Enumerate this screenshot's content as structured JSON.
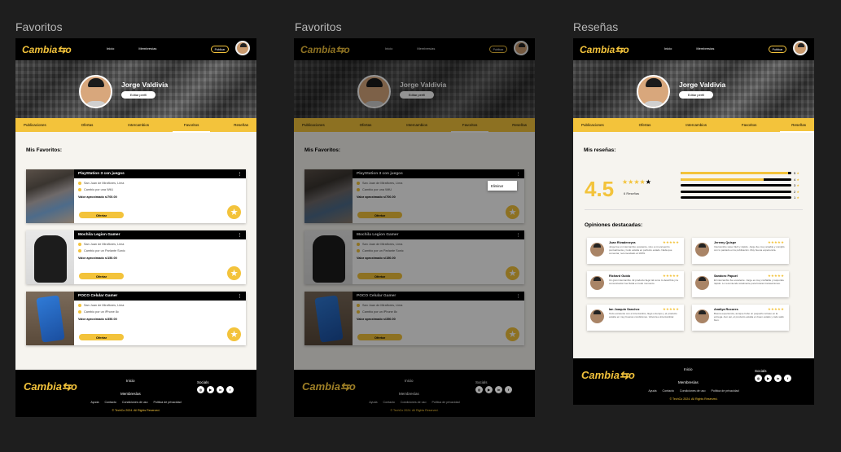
{
  "frames": [
    {
      "label": "Favoritos"
    },
    {
      "label": "Favoritos"
    },
    {
      "label": "Reseñas"
    }
  ],
  "nav": {
    "logo": "Cambia⇆o",
    "inicio": "Inicio",
    "membresias": "Membresías",
    "publicar": "Publicar"
  },
  "profile": {
    "name": "Jorge Valdivia",
    "edit": "Editar perfil"
  },
  "tabs": [
    "Publicaciones",
    "Ofertas",
    "Intercambios",
    "Favoritos",
    "Reseñas"
  ],
  "favorites": {
    "title": "Mis Favoritos:",
    "cards": [
      {
        "title": "PlayStation 3 con juegos",
        "location": "San Juan de Miraflores, Lima",
        "exchange": "Cambio por una WiiU",
        "value": "Valor aproximado s/700.00",
        "button": "Ofertar"
      },
      {
        "title": "Mochila Legion Gamer",
        "location": "San Juan de Miraflores, Lima",
        "exchange": "Cambio por un Parlante Sonic",
        "value": "Valor aproximado s/150.00",
        "button": "Ofertar"
      },
      {
        "title": "POCO Celular Gamer",
        "location": "San Juan de Miraflores, Lima",
        "exchange": "Cambio por un iPhone 8c",
        "value": "Valor aproximado s/350.00",
        "button": "Ofertar"
      }
    ],
    "menu_item": "Eliminar"
  },
  "reviews": {
    "title": "Mis reseñas:",
    "score": "4.5",
    "count": "6 Reseñas",
    "bars": [
      {
        "label": "5",
        "fill": 0.97
      },
      {
        "label": "4",
        "fill": 0.75
      },
      {
        "label": "3",
        "fill": 0
      },
      {
        "label": "2",
        "fill": 0
      },
      {
        "label": "1",
        "fill": 0
      }
    ],
    "highlights_title": "Opiniones destacadas:",
    "items": [
      {
        "name": "Juan Rivadeneyra",
        "stars": "★★★★★",
        "text": "Jorge fue un intercambio excelente, vino a mi encuentro puntualmente y todo estaba en perfecto estado. Nada que comentar, recomendado al 100%."
      },
      {
        "name": "Jeremy Quispe",
        "stars": "★★★★★",
        "text": "Intercambio súper fácil y rápido. Jorge fue muy amable y cumplió con lo pactado en la publicación. Muy buena experiencia."
      },
      {
        "name": "Richard Guido",
        "stars": "★★★★★",
        "text": "Un gran intercambio. El producto llegó tal como lo describía y la comunicación fue fluida en todo momento."
      },
      {
        "name": "Sandoro Papuel",
        "stars": "★★★★★",
        "text": "El intercambio fue excelente. Jorge es muy confiable y responde rápido. Lo recomiendo totalmente para futuras transacciones."
      },
      {
        "name": "Ian Joaquin Sanchez",
        "stars": "★★★★★",
        "text": "Todo excelente con el intercambio, llegó a tiempo y el producto estaba en muy buenas condiciones. Volvería a intercambiar."
      },
      {
        "name": "Analiya Rocores",
        "stars": "★★★★★",
        "text": "Buena experiencia, aunque hubo un pequeño retraso en la entrega. Aun así, el producto estaba en buen estado y todo salió bien."
      }
    ]
  },
  "footer": {
    "logo": "Cambia⇆o",
    "inicio": "Inicio",
    "membresias": "Membresías",
    "socials_title": "Socials",
    "socials": [
      "◎",
      "▶",
      "in",
      "f"
    ],
    "links": [
      "Ayuda",
      "Contacto",
      "Condiciones de uso",
      "Política de privacidad"
    ],
    "copyright": "© TechCo 2024. All Rights Reserved."
  },
  "colors": {
    "accent": "#f3c33b",
    "dark": "#000000",
    "bg": "#1e1e1e"
  }
}
